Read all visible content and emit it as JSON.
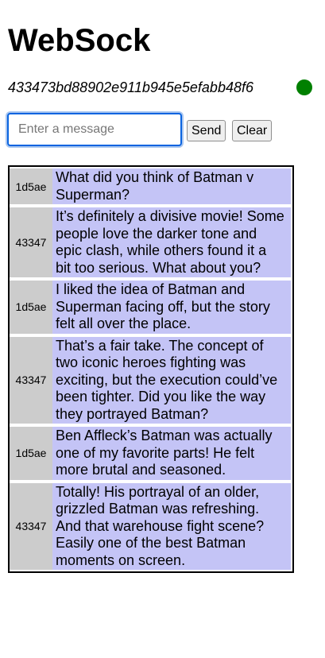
{
  "header": {
    "title": "WebSock",
    "client_id": "433473bd88902e911b945e5efabb48f6",
    "status_color": "#008000"
  },
  "composer": {
    "placeholder": "Enter a message",
    "value": "",
    "send_label": "Send",
    "clear_label": "Clear"
  },
  "messages": [
    {
      "sender": "1d5ae",
      "text": "What did you think of Batman v Superman?"
    },
    {
      "sender": "43347",
      "text": "It’s definitely a divisive movie! Some people love the darker tone and epic clash, while others found it a bit too serious. What about you?"
    },
    {
      "sender": "1d5ae",
      "text": "I liked the idea of Batman and Superman facing off, but the story felt all over the place."
    },
    {
      "sender": "43347",
      "text": "That’s a fair take. The concept of two iconic heroes fighting was exciting, but the execution could’ve been tighter. Did you like the way they portrayed Batman?"
    },
    {
      "sender": "1d5ae",
      "text": "Ben Affleck’s Batman was actually one of my favorite parts! He felt more brutal and seasoned."
    },
    {
      "sender": "43347",
      "text": "Totally! His portrayal of an older, grizzled Batman was refreshing. And that warehouse fight scene? Easily one of the best Batman moments on screen."
    }
  ]
}
